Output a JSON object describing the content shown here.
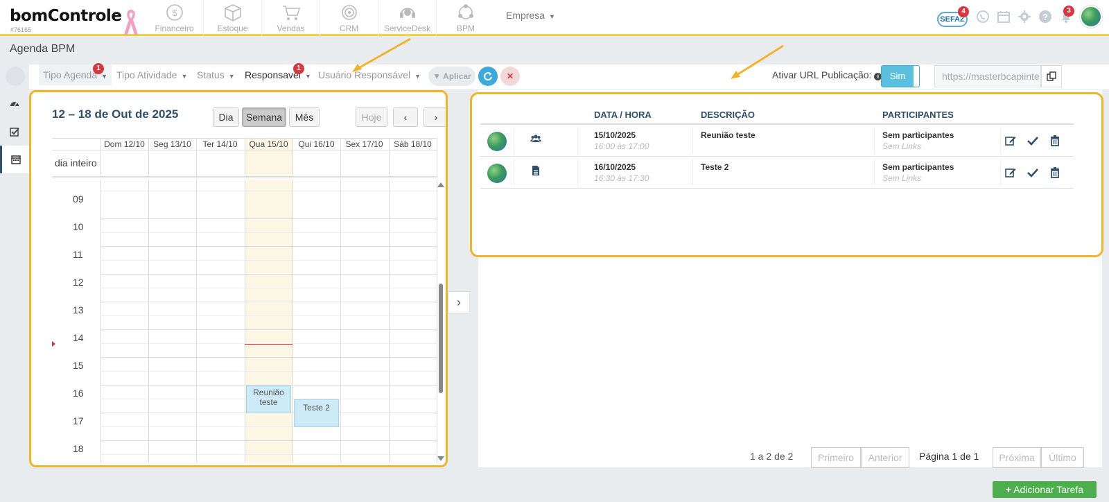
{
  "header": {
    "logo_text": "bomControle",
    "logo_id": "#76165",
    "modules": [
      {
        "label": "Financeiro",
        "icon": "dollar-icon"
      },
      {
        "label": "Estoque",
        "icon": "box-icon"
      },
      {
        "label": "Vendas",
        "icon": "cart-icon"
      },
      {
        "label": "CRM",
        "icon": "target-icon"
      },
      {
        "label": "ServiceDesk",
        "icon": "headset-icon"
      },
      {
        "label": "BPM",
        "icon": "network-icon"
      }
    ],
    "company_label": "Empresa",
    "sefaz_label": "SEFAZ",
    "sefaz_badge": "4",
    "notifications_badge": "3"
  },
  "page": {
    "title": "Agenda BPM"
  },
  "filters": {
    "tipo_agenda": "Tipo Agenda",
    "tipo_agenda_badge": "1",
    "tipo_atividade": "Tipo Atividade",
    "status": "Status",
    "responsavel": "Responsavel",
    "responsavel_badge": "1",
    "usuario_responsavel": "Usuário Responsável",
    "apply_label": "Aplicar",
    "url_label": "Ativar URL Publicação:",
    "url_toggle": "Sim",
    "url_value": "https://masterbcapiinte"
  },
  "calendar": {
    "title": "12 – 18 de Out de 2025",
    "view_buttons": [
      "Dia",
      "Semana",
      "Mês"
    ],
    "today_button": "Hoje",
    "days": [
      "Dom 12/10",
      "Seg 13/10",
      "Ter 14/10",
      "Qua 15/10",
      "Qui 16/10",
      "Sex 17/10",
      "Sáb 18/10"
    ],
    "allday_label": "dia inteiro",
    "hours": [
      "09",
      "10",
      "11",
      "12",
      "13",
      "14",
      "15",
      "16",
      "17",
      "18"
    ],
    "events": [
      {
        "title": "Reunião teste",
        "day": "Qua 15/10",
        "start": "16:00",
        "end": "17:00"
      },
      {
        "title": "Teste 2",
        "day": "Qui 16/10",
        "start": "16:30",
        "end": "17:30"
      }
    ]
  },
  "tasks": {
    "columns": [
      "DATA / HORA",
      "DESCRIÇÃO",
      "PARTICIPANTES"
    ],
    "rows": [
      {
        "date": "15/10/2025",
        "time": "16:00 às 17:00",
        "description": "Reunião teste",
        "participants": "Sem participantes",
        "links": "Sem Links",
        "type_icon": "users-icon"
      },
      {
        "date": "16/10/2025",
        "time": "16:30 às 17:30",
        "description": "Teste 2",
        "participants": "Sem participantes",
        "links": "Sem Links",
        "type_icon": "document-icon"
      }
    ]
  },
  "pagination": {
    "count": "1 a 2 de 2",
    "first": "Primeiro",
    "previous": "Anterior",
    "page": "Página 1 de 1",
    "next": "Próxima",
    "last": "Último"
  },
  "add_task_label": "Adicionar Tarefa",
  "colors": {
    "highlight_border": "#f0b429",
    "topbar_border": "#f2d23c",
    "primary_text": "#2f4f6f",
    "today_bg": "#fcf7e5",
    "event_bg": "#cdeaf7",
    "add_button": "#4cae4c",
    "badge": "#d9363e"
  }
}
